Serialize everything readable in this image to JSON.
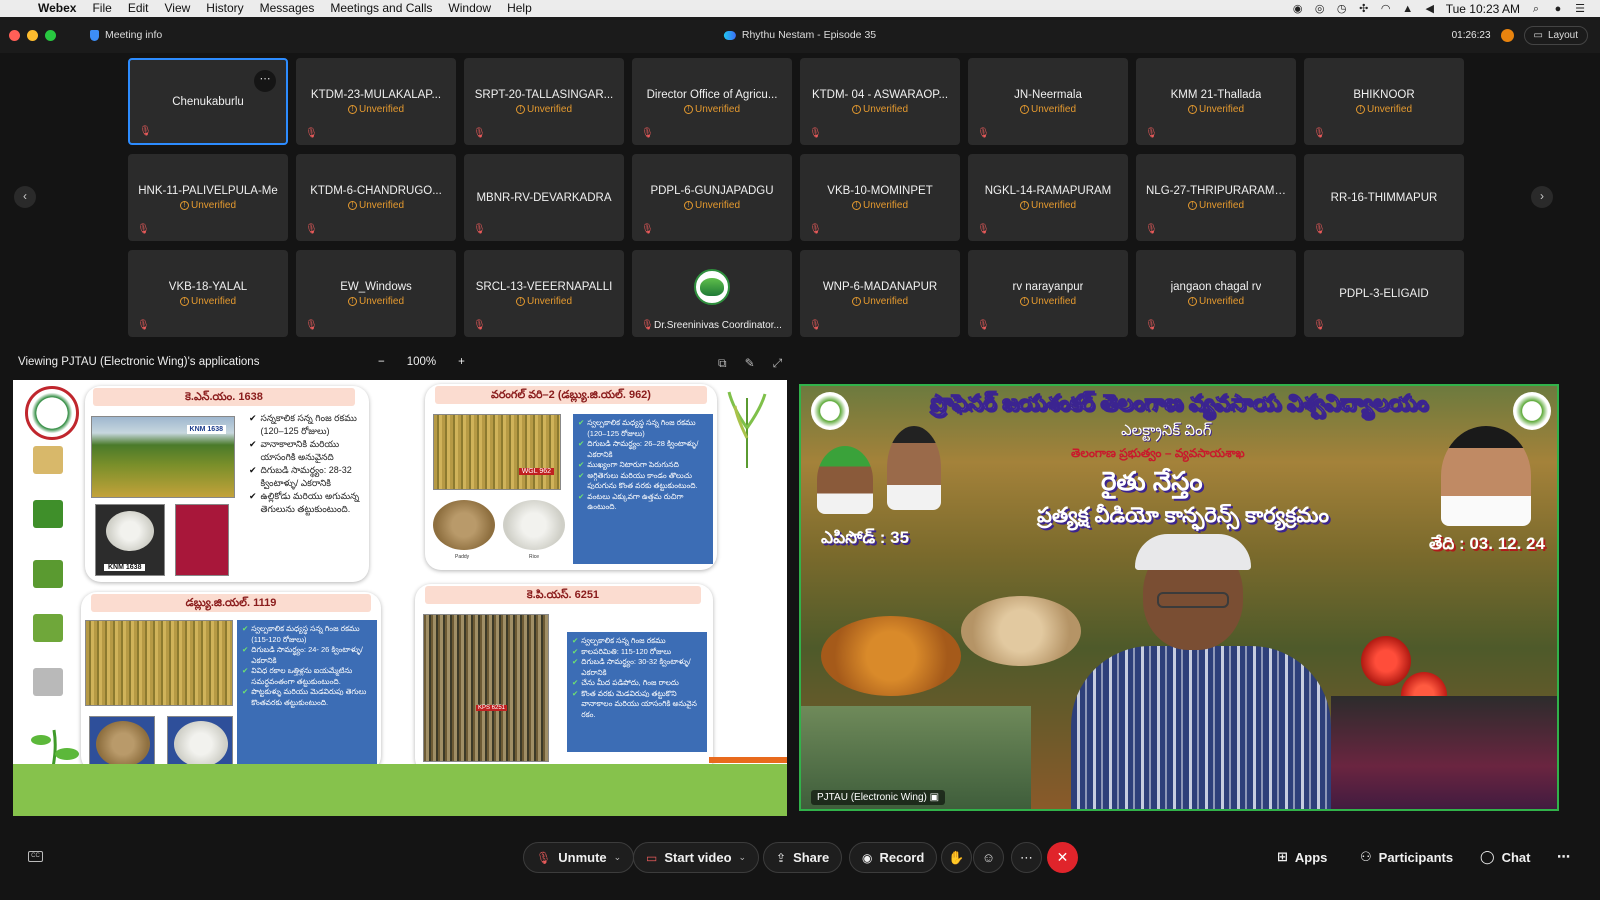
{
  "menubar": {
    "app_name": "Webex",
    "items": [
      "File",
      "Edit",
      "View",
      "History",
      "Messages",
      "Meetings and Calls",
      "Window",
      "Help"
    ],
    "clock": "Tue 10:23 AM"
  },
  "titlebar": {
    "meeting_info": "Meeting info",
    "title": "Rhythu Nestam - Episode 35",
    "timer": "01:26:23",
    "layout_label": "Layout"
  },
  "participants": [
    {
      "name": "Chenukaburlu",
      "status": ""
    },
    {
      "name": "KTDM-23-MULAKALAP...",
      "status": "Unverified"
    },
    {
      "name": "SRPT-20-TALLASINGAR...",
      "status": "Unverified"
    },
    {
      "name": "Director Office of Agricu...",
      "status": "Unverified"
    },
    {
      "name": "KTDM- 04 - ASWARAOP...",
      "status": "Unverified"
    },
    {
      "name": "JN-Neermala",
      "status": "Unverified"
    },
    {
      "name": "KMM 21-Thallada",
      "status": "Unverified"
    },
    {
      "name": "BHIKNOOR",
      "status": "Unverified"
    },
    {
      "name": "HNK-11-PALIVELPULA-Me",
      "status": "Unverified"
    },
    {
      "name": "KTDM-6-CHANDRUGO...",
      "status": "Unverified"
    },
    {
      "name": "MBNR-RV-DEVARKADRA",
      "status": ""
    },
    {
      "name": "PDPL-6-GUNJAPADGU",
      "status": "Unverified"
    },
    {
      "name": "VKB-10-MOMINPET",
      "status": "Unverified"
    },
    {
      "name": "NGKL-14-RAMAPURAM",
      "status": "Unverified"
    },
    {
      "name": "NLG-27-THRIPURARAM....",
      "status": "Unverified"
    },
    {
      "name": "RR-16-THIMMAPUR",
      "status": ""
    },
    {
      "name": "VKB-18-YALAL",
      "status": "Unverified"
    },
    {
      "name": "EW_Windows",
      "status": "Unverified"
    },
    {
      "name": "SRCL-13-VEEERNAPALLI",
      "status": "Unverified"
    },
    {
      "name": "Dr.Sreeninivas Coordinator...",
      "status": ""
    },
    {
      "name": "WNP-6-MADANAPUR",
      "status": "Unverified"
    },
    {
      "name": "rv narayanpur",
      "status": "Unverified"
    },
    {
      "name": "jangaon chagal rv",
      "status": "Unverified"
    },
    {
      "name": "PDPL-3-ELIGAID",
      "status": ""
    }
  ],
  "share": {
    "viewing_label": "Viewing PJTAU (Electronic Wing)'s applications",
    "zoom_minus": "−",
    "zoom_value": "100%",
    "zoom_plus": "+"
  },
  "slide": {
    "card1_title": "కె.ఎన్.యం. 1638",
    "card1_photo_label": "KNM 1638",
    "card1_grain_label": "KNM 1638",
    "card1_bullets": [
      "సన్నకాలిక సన్న గింజ రకము (120–125 రోజులు)",
      "వానాకాలానికి మరియు యాసంగికి అనువైనది",
      "దిగుబడి సామర్థ్యం: 28-32 క్వింటాళ్ళు/ ఎకరానికి",
      "ఉల్లికోడు మరియు అగుమన్న తెగులును తట్టుకుంటుంది."
    ],
    "card2_title": "వరంగల్ వరి–2 (డబ్ల్యు.జి.యల్. 962)",
    "card2_photo_label": "WGL 962",
    "card2_bullets": [
      "స్వల్పకాలిక మధ్యస్థ సన్న గింజ రకము (120–125 రోజులు)",
      "దిగుబడి సామర్థ్యం: 26–28 క్వింటాళ్ళు/ ఎకరానికి",
      "ముఖ్యంగా నిటారుగా పెరుగునది",
      "అగ్గితెగులు మరియు కాండం తొలుచు పురుగును కొంత వరకు తట్టుకుంటుంది.",
      "వంటలు ఎక్కువగా ఉత్తమ రుచిగా ఉంటుంది."
    ],
    "card2_grain_labels": [
      "Paddy",
      "Rice"
    ],
    "card3_title": "డబ్ల్యు.జి.యల్. 1119",
    "card3_bullets": [
      "స్వల్పకాలిక మధ్యస్థ సన్న గింజ రకము (115-120 రోజులు)",
      "దిగుబడి సామర్థ్యం: 24- 26 క్వింటాళ్ళు/ ఎకరానికి",
      "వివిధ రకాల ఒత్తిళ్లను ఐయమ్మేటిను సమర్థవంతంగా తట్టుకుంటుంది.",
      "పొట్టకుళ్ళు మరియు మెడవిరుపు తెగులు కొంతవరకు తట్టుకుంటుంది."
    ],
    "card4_title": "కె.పి.యస్. 6251",
    "card4_photo_label": "KPS 6251",
    "card4_bullets": [
      "స్వల్పకాలిక సన్న గింజ రకము",
      "కాలపరిమితి: 115-120 రోజులు",
      "దిగుబడి సామర్థ్యం: 30-32 క్వింటాళ్ళు/ ఎకరానికి",
      "చేను మీద పడిపోదు, గింజ రాలదు",
      "కొంత వరకు మెడవిరుపు తట్టుకొని వానాకాలం మరియు యాసంగికి అనువైన రకం."
    ]
  },
  "video": {
    "banner_university": "ప్రొఫెసర్ జయశంకర్ తెలంగాణ వ్యవసాయ విశ్వవిద్యాలయం",
    "banner_wing": "ఎలక్ట్రానిక్ వింగ్",
    "banner_govt": "తెలంగాణ ప్రభుత్వం – వ్యవసాయశాఖ",
    "banner_program": "రైతు నేస్తం",
    "banner_subtitle": "ప్రత్యక్ష వీడియో కాన్ఫరెన్స్ కార్యక్రమం",
    "episode": "ఎపిసోడ్ : 35",
    "date": "తేది : 03. 12. 24",
    "participant_label": "PJTAU (Electronic Wing)"
  },
  "toolbar": {
    "unmute": "Unmute",
    "start_video": "Start video",
    "share": "Share",
    "record": "Record",
    "apps": "Apps",
    "participants": "Participants",
    "chat": "Chat"
  },
  "colors": {
    "accent": "#2d8cff",
    "unverified": "#e59a2f",
    "end_call": "#e0242b",
    "video_border": "#31b24a"
  }
}
